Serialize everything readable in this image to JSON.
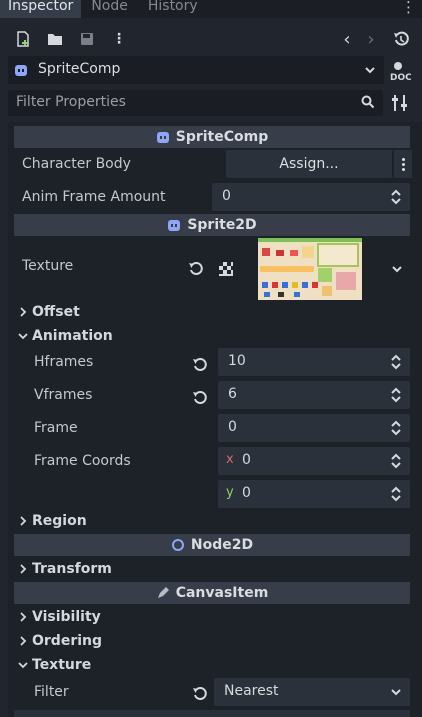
{
  "tabs": [
    {
      "label": "Inspector",
      "active": true
    },
    {
      "label": "Node",
      "active": false
    },
    {
      "label": "History",
      "active": false
    }
  ],
  "toolbar": {
    "back": "‹",
    "forward": "›"
  },
  "object": {
    "name": "SpriteComp"
  },
  "filter": {
    "placeholder": "Filter Properties"
  },
  "sections": {
    "sprite_comp": {
      "title": "SpriteComp",
      "character_body": {
        "label": "Character Body",
        "button": "Assign..."
      },
      "anim_frame_amount": {
        "label": "Anim Frame Amount",
        "value": "0"
      }
    },
    "sprite2d": {
      "title": "Sprite2D",
      "texture": {
        "label": "Texture"
      },
      "offset": "Offset",
      "animation": "Animation",
      "hframes": {
        "label": "Hframes",
        "value": "10"
      },
      "vframes": {
        "label": "Vframes",
        "value": "6"
      },
      "frame": {
        "label": "Frame",
        "value": "0"
      },
      "frame_coords": {
        "label": "Frame Coords",
        "x_label": "x",
        "x": "0",
        "y_label": "y",
        "y": "0"
      },
      "region": "Region"
    },
    "node2d": {
      "title": "Node2D",
      "transform": "Transform"
    },
    "canvas_item": {
      "title": "CanvasItem",
      "visibility": "Visibility",
      "ordering": "Ordering",
      "texture": "Texture",
      "filter": {
        "label": "Filter",
        "value": "Nearest"
      }
    }
  },
  "colors": {
    "panel": "#1d2128",
    "header": "#373e4a",
    "field": "#2b313a",
    "accent_x": "#d46a6a",
    "accent_y": "#8fd16a",
    "node_icon": "#8ea6f5"
  }
}
